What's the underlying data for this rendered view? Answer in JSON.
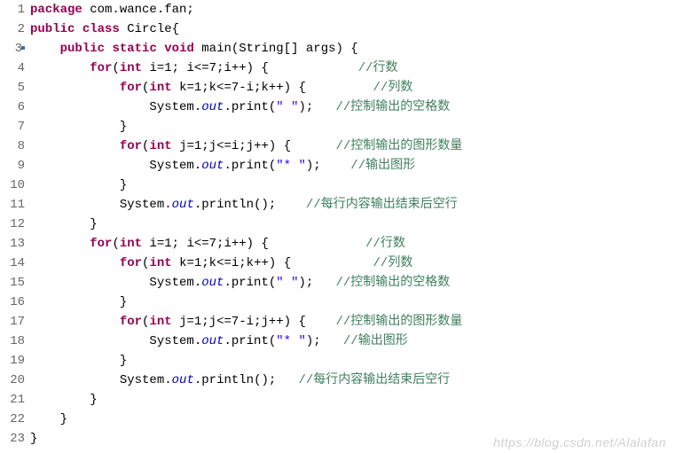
{
  "lines": [
    {
      "n": "1",
      "html": "<span class='kw'>package</span><span class='pl'> com.wance.fan;</span>"
    },
    {
      "n": "2",
      "html": "<span class='kw'>public</span><span class='pl'> </span><span class='kw'>class</span><span class='pl'> Circle{</span>"
    },
    {
      "n": "3",
      "mark": true,
      "html": "<span class='pl'>    </span><span class='kw'>public</span><span class='pl'> </span><span class='kw'>static</span><span class='pl'> </span><span class='kw'>void</span><span class='pl'> main(String[] args) {</span>"
    },
    {
      "n": "4",
      "html": "<span class='pl'>        </span><span class='kw'>for</span><span class='pl'>(</span><span class='kw'>int</span><span class='pl'> i=1; i&lt;=7;i++) {            </span><span class='cmt'>//行数</span>"
    },
    {
      "n": "5",
      "html": "<span class='pl'>            </span><span class='kw'>for</span><span class='pl'>(</span><span class='kw'>int</span><span class='pl'> k=1;k&lt;=7-i;k++) {         </span><span class='cmt'>//列数</span>"
    },
    {
      "n": "6",
      "html": "<span class='pl'>                System.</span><span class='fld'>out</span><span class='pl'>.print(</span><span class='str'>\" \"</span><span class='pl'>);   </span><span class='cmt'>//控制输出的空格数</span>"
    },
    {
      "n": "7",
      "html": "<span class='pl'>            }</span>"
    },
    {
      "n": "8",
      "html": "<span class='pl'>            </span><span class='kw'>for</span><span class='pl'>(</span><span class='kw'>int</span><span class='pl'> j=1;j&lt;=i;j++) {      </span><span class='cmt'>//控制输出的图形数量</span>"
    },
    {
      "n": "9",
      "html": "<span class='pl'>                System.</span><span class='fld'>out</span><span class='pl'>.print(</span><span class='str'>\"* \"</span><span class='pl'>);    </span><span class='cmt'>//输出图形</span>"
    },
    {
      "n": "10",
      "html": "<span class='pl'>            }</span>"
    },
    {
      "n": "11",
      "html": "<span class='pl'>            System.</span><span class='fld'>out</span><span class='pl'>.println();    </span><span class='cmt'>//每行内容输出结束后空行</span>"
    },
    {
      "n": "12",
      "html": "<span class='pl'>        }</span>"
    },
    {
      "n": "13",
      "html": "<span class='pl'>        </span><span class='kw'>for</span><span class='pl'>(</span><span class='kw'>int</span><span class='pl'> i=1; i&lt;=7;i++) {             </span><span class='cmt'>//行数</span>"
    },
    {
      "n": "14",
      "html": "<span class='pl'>            </span><span class='kw'>for</span><span class='pl'>(</span><span class='kw'>int</span><span class='pl'> k=1;k&lt;=i;k++) {           </span><span class='cmt'>//列数</span>"
    },
    {
      "n": "15",
      "html": "<span class='pl'>                System.</span><span class='fld'>out</span><span class='pl'>.print(</span><span class='str'>\" \"</span><span class='pl'>);   </span><span class='cmt'>//控制输出的空格数</span>"
    },
    {
      "n": "16",
      "html": "<span class='pl'>            }</span>"
    },
    {
      "n": "17",
      "html": "<span class='pl'>            </span><span class='kw'>for</span><span class='pl'>(</span><span class='kw'>int</span><span class='pl'> j=1;j&lt;=7-i;j++) {    </span><span class='cmt'>//控制输出的图形数量</span>"
    },
    {
      "n": "18",
      "html": "<span class='pl'>                System.</span><span class='fld'>out</span><span class='pl'>.print(</span><span class='str'>\"* \"</span><span class='pl'>);   </span><span class='cmt'>//输出图形</span>"
    },
    {
      "n": "19",
      "html": "<span class='pl'>            }</span>"
    },
    {
      "n": "20",
      "html": "<span class='pl'>            System.</span><span class='fld'>out</span><span class='pl'>.println();   </span><span class='cmt'>//每行内容输出结束后空行</span>"
    },
    {
      "n": "21",
      "html": "<span class='pl'>        }</span>"
    },
    {
      "n": "22",
      "html": "<span class='pl'>    }</span>"
    },
    {
      "n": "23",
      "html": "<span class='pl'>}</span>"
    }
  ],
  "watermark": "https://blog.csdn.net/Alalafan"
}
